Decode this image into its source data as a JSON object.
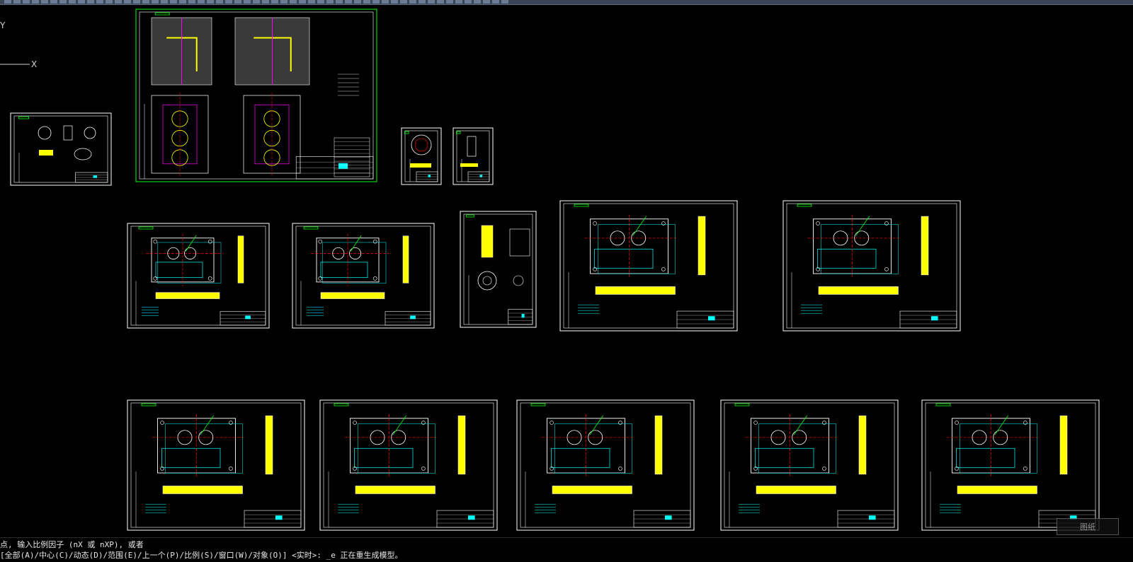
{
  "toolbar": {
    "button_count": 55
  },
  "viewport": {
    "ucs_y_label": "Y",
    "ucs_x_label": "X"
  },
  "command_line": {
    "line1": "点, 输入比例因子 (nX 或 nXP), 或者",
    "line2": "[全部(A)/中心(C)/动态(D)/范围(E)/上一个(P)/比例(S)/窗口(W)/对象(O)] <实时>: _e 正在重生成模型。"
  },
  "watermark": {
    "text": "图纸"
  },
  "colors": {
    "frame": "#ffffff",
    "accent_green": "#00ff00",
    "cyan": "#00ffff",
    "yellow": "#ffff00",
    "red": "#ff0000",
    "magenta": "#ff00ff"
  }
}
